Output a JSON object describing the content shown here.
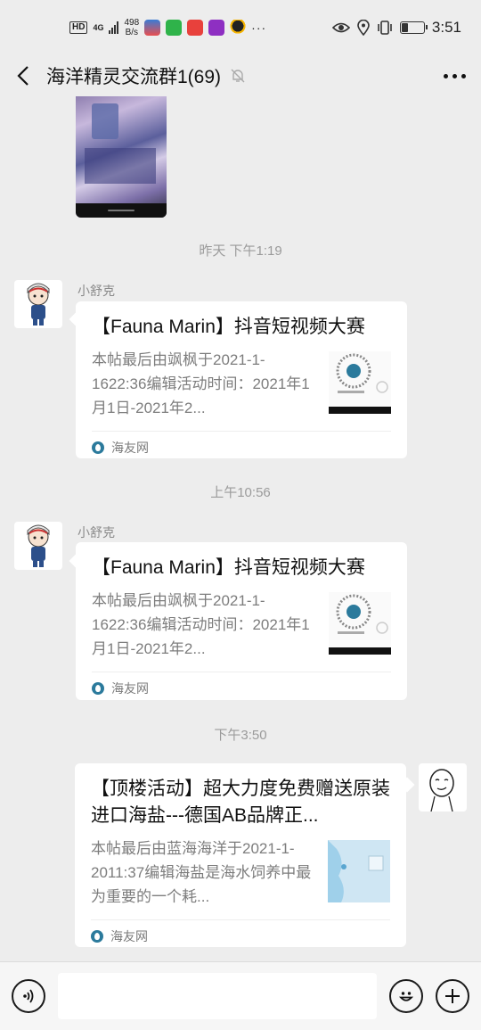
{
  "status_bar": {
    "hd": "HD",
    "network": "4G",
    "speed_value": "498",
    "speed_unit": "B/s",
    "time": "3:51",
    "battery_level": 0.3,
    "icons": [
      "eye-icon",
      "location-icon",
      "vibrate-icon",
      "battery-icon"
    ]
  },
  "header": {
    "title": "海洋精灵交流群1(69)",
    "icons": [
      "back-icon",
      "mute-bell-icon",
      "more-icon"
    ]
  },
  "timestamps": {
    "t1": "昨天 下午1:19",
    "t2": "上午10:56",
    "t3": "下午3:50"
  },
  "messages": [
    {
      "sender": "小舒克",
      "card_title": "【Fauna Marin】抖音短视频大赛",
      "card_desc": "本帖最后由飒枫于2021-1-1622:36编辑活动时间：2021年1月1日-2021年2...",
      "source": "海友网"
    },
    {
      "sender": "小舒克",
      "card_title": "【Fauna Marin】抖音短视频大赛",
      "card_desc": "本帖最后由飒枫于2021-1-1622:36编辑活动时间：2021年1月1日-2021年2...",
      "source": "海友网"
    },
    {
      "sender": "",
      "card_title": "【顶楼活动】超大力度免费赠送原装进口海盐---德国AB品牌正...",
      "card_desc": "本帖最后由蓝海海洋于2021-1-2011:37编辑海盐是海水饲养中最为重要的一个耗...",
      "source": "海友网"
    }
  ],
  "input_bar": {
    "icons": [
      "voice-icon",
      "emoji-icon",
      "plus-icon"
    ]
  }
}
